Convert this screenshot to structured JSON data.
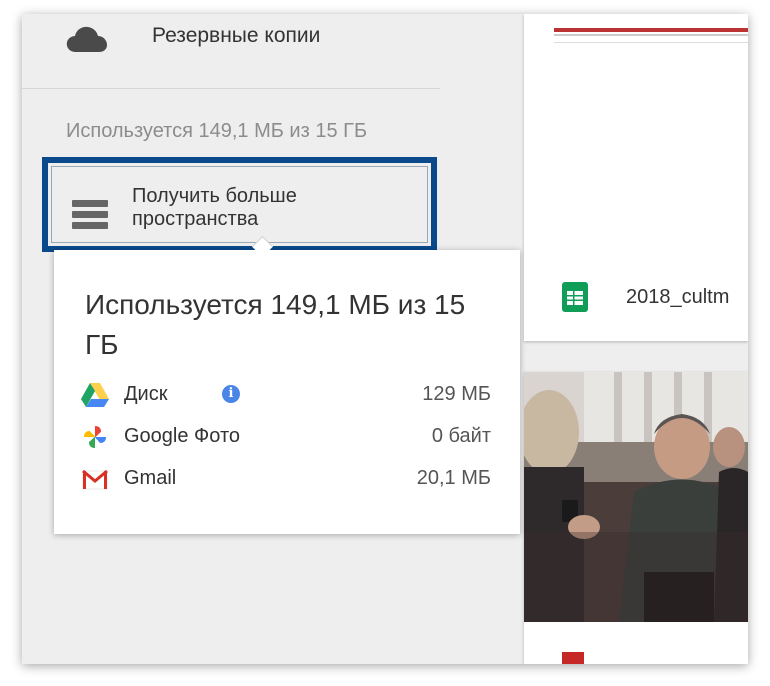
{
  "sidebar": {
    "backup_label": "Резервные копии",
    "usage_text": "Используется 149,1 МБ из 15 ГБ",
    "get_space_label_line1": "Получить больше",
    "get_space_label_line2": "пространства"
  },
  "popup": {
    "title": "Используется 149,1 МБ из 15 ГБ",
    "rows": [
      {
        "label": "Диск",
        "value": "129 МБ",
        "icon": "google-drive-icon"
      },
      {
        "label": "Google Фото",
        "value": "0 байт",
        "icon": "google-photos-icon"
      },
      {
        "label": "Gmail",
        "value": "20,1 МБ",
        "icon": "gmail-icon"
      }
    ],
    "info_glyph": "i"
  },
  "files": {
    "top_file_name": "2018_cultm",
    "top_file_icon": "google-sheets-icon"
  },
  "colors": {
    "highlight_border": "#0a4a8c",
    "drive_green": "#1fa463",
    "drive_yellow": "#ffd04b",
    "drive_blue": "#4687f4",
    "gmail_red": "#d93025",
    "sheets_green": "#0f9d58",
    "info_blue": "#4a86e8"
  }
}
